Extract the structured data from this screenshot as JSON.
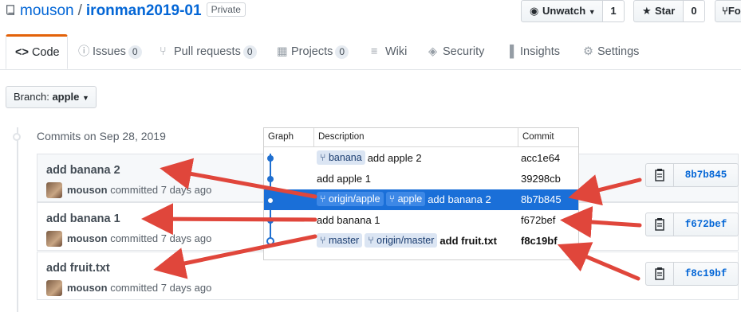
{
  "repo": {
    "owner": "mouson",
    "separator": "/",
    "name": "ironman2019-01",
    "visibility": "Private"
  },
  "header_actions": {
    "watch": {
      "label": "Unwatch",
      "count": "1"
    },
    "star": {
      "label": "Star",
      "count": "0"
    },
    "fork": {
      "label": "Fo"
    }
  },
  "tabs": [
    {
      "label": "Code",
      "icon": "code-icon",
      "active": true
    },
    {
      "label": "Issues",
      "count": "0",
      "icon": "issue-icon"
    },
    {
      "label": "Pull requests",
      "count": "0",
      "icon": "pull-request-icon"
    },
    {
      "label": "Projects",
      "count": "0",
      "icon": "project-icon"
    },
    {
      "label": "Wiki",
      "icon": "book-icon"
    },
    {
      "label": "Security",
      "icon": "shield-icon"
    },
    {
      "label": "Insights",
      "icon": "graph-icon"
    },
    {
      "label": "Settings",
      "icon": "gear-icon"
    }
  ],
  "branch": {
    "prefix": "Branch:",
    "name": "apple"
  },
  "commits_heading": "Commits on Sep 28, 2019",
  "commits": [
    {
      "message": "add banana 2",
      "author": "mouson",
      "action": "committed 7 days ago",
      "sha": "8b7b845"
    },
    {
      "message": "add banana 1",
      "author": "mouson",
      "action": "committed 7 days ago",
      "sha": "f672bef"
    },
    {
      "message": "add fruit.txt",
      "author": "mouson",
      "action": "committed 7 days ago",
      "sha": "f8c19bf"
    }
  ],
  "overlay": {
    "columns": {
      "graph": "Graph",
      "description": "Description",
      "commit": "Commit"
    },
    "rows": [
      {
        "tags": [
          "banana"
        ],
        "message": "add apple 2",
        "sha": "acc1e64"
      },
      {
        "tags": [],
        "message": "add apple 1",
        "sha": "39298cb"
      },
      {
        "tags": [
          "origin/apple",
          "apple"
        ],
        "message": "add banana 2",
        "sha": "8b7b845",
        "selected": true
      },
      {
        "tags": [],
        "message": "add banana 1",
        "sha": "f672bef"
      },
      {
        "tags": [
          "master",
          "origin/master"
        ],
        "message": "add fruit.txt",
        "sha": "f8c19bf",
        "bold": true
      }
    ]
  },
  "colors": {
    "accent": "#e36209",
    "link": "#0366d6",
    "selection": "#1a6fd8",
    "arrow": "#e0463b"
  }
}
